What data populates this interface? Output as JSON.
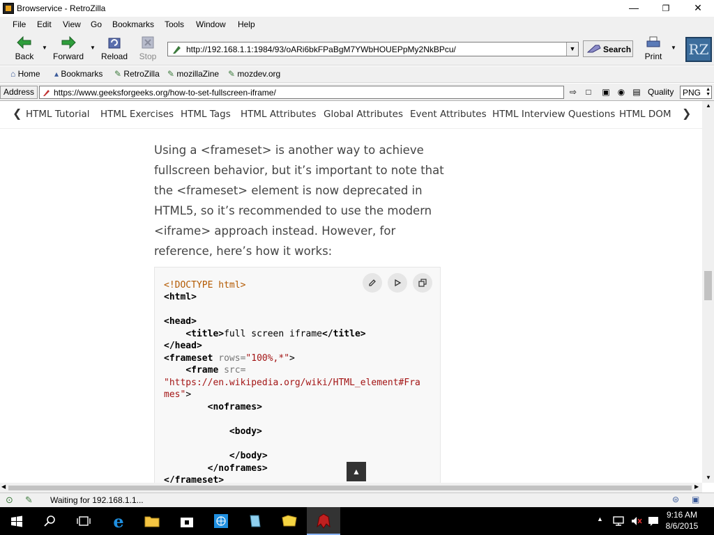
{
  "window": {
    "title": "Browservice - RetroZilla",
    "controls": [
      "minimize-icon",
      "maximize-icon",
      "close-icon"
    ]
  },
  "menu": [
    "File",
    "Edit",
    "View",
    "Go",
    "Bookmarks",
    "Tools",
    "Window",
    "Help"
  ],
  "nav": {
    "back": "Back",
    "forward": "Forward",
    "reload": "Reload",
    "stop": "Stop",
    "url": "http://192.168.1.1:1984/93/oARi6bkFPaBgM7YWbHOUEPpMy2NkBPcu/",
    "search": "Search",
    "print": "Print",
    "logo": "RZ"
  },
  "bookmarks": [
    "Home",
    "Bookmarks",
    "RetroZilla",
    "mozillaZine",
    "mozdev.org"
  ],
  "address": {
    "label": "Address",
    "url": "https://www.geeksforgeeks.org/how-to-set-fullscreen-iframe/",
    "quality_label": "Quality",
    "quality_value": "PNG"
  },
  "topnav": [
    "HTML Tutorial",
    "HTML Exercises",
    "HTML Tags",
    "HTML Attributes",
    "Global Attributes",
    "Event Attributes",
    "HTML Interview Questions",
    "HTML DOM"
  ],
  "article": {
    "lines": [
      "Using a <frameset> is another way to achieve",
      "fullscreen behavior, but it’s important to note that",
      "the <frameset> element is now deprecated in",
      "HTML5, so it’s recommended to use the modern",
      "<iframe> approach instead. However, for",
      "reference, here’s how it works:"
    ]
  },
  "code": {
    "doctype": "<!DOCTYPE html>",
    "html_open": "<html>",
    "head_open": "<head>",
    "title_open": "<title>",
    "title_text": "full screen iframe",
    "title_close": "</title>",
    "head_close": "</head>",
    "frameset_open": "<frameset",
    "rows_attr": " rows=",
    "rows_val": "\"100%,*\"",
    "frameset_end": ">",
    "frame_open": "<frame",
    "src_attr": " src=",
    "src_val_1": "\"https://en.wikipedia.org/wiki/HTML_element#Fra",
    "src_val_2": "mes\"",
    "frame_end": ">",
    "noframes_open": "<noframes>",
    "body_open": "<body>",
    "body_close": "</body>",
    "noframes_close": "</noframes>",
    "frameset_close": "</frameset>"
  },
  "status": {
    "text": "Waiting for 192.168.1.1..."
  },
  "taskbar": {
    "time": "9:16 AM",
    "date": "8/6/2015"
  }
}
